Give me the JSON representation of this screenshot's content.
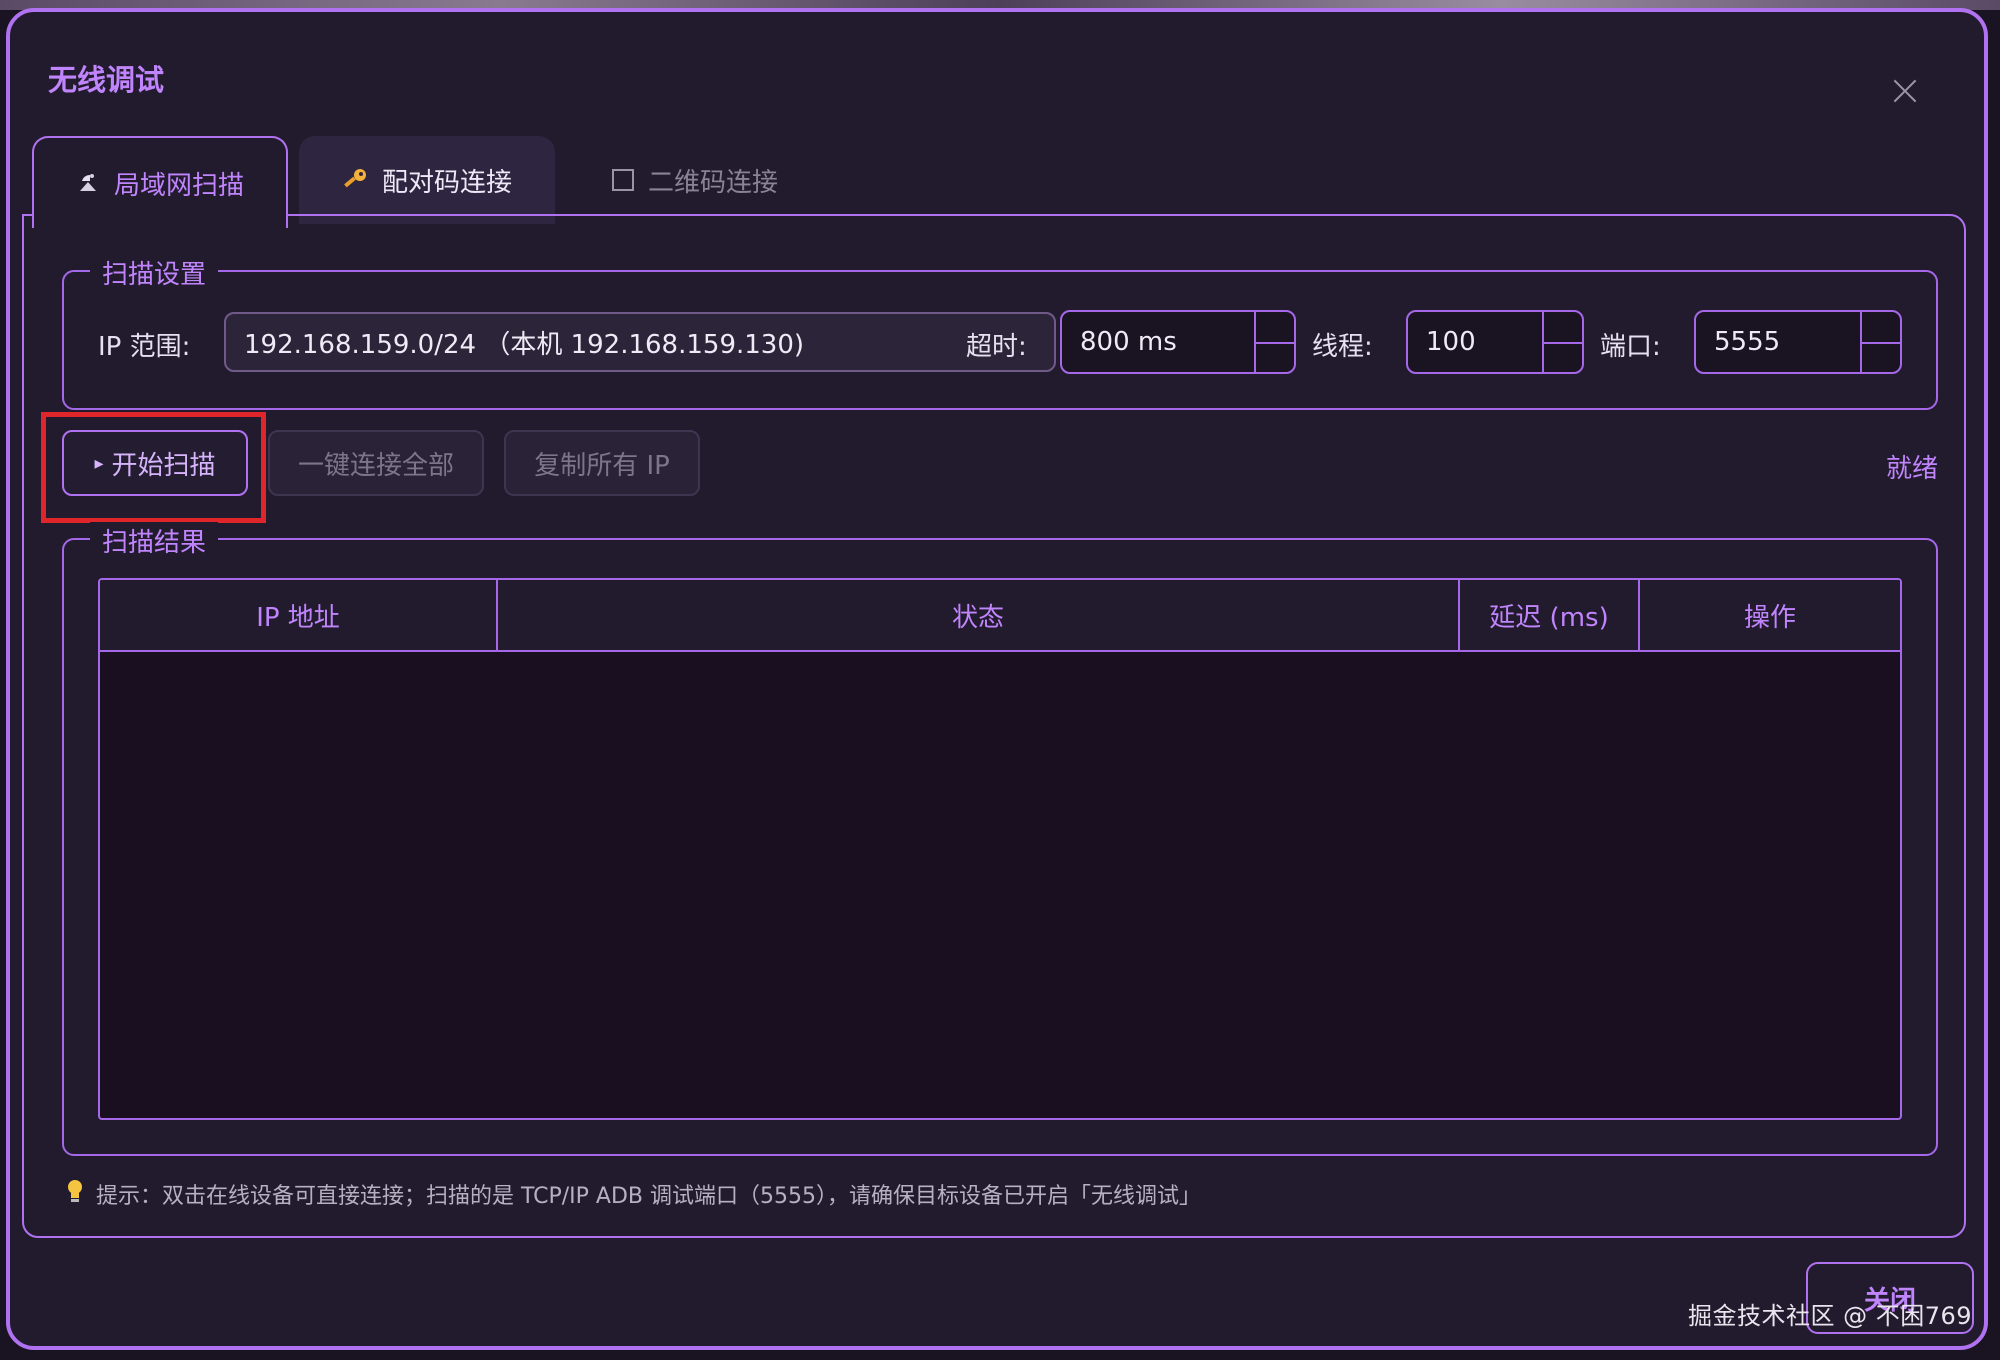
{
  "dialog": {
    "title": "无线调试",
    "close_icon": "close-icon"
  },
  "tabs": [
    {
      "label": "局域网扫描",
      "icon": "radar-dish-icon",
      "active": true
    },
    {
      "label": "配对码连接",
      "icon": "key-icon",
      "active": false
    },
    {
      "label": "二维码连接",
      "icon": "checkbox-icon",
      "active": false
    }
  ],
  "scan_settings": {
    "legend": "扫描设置",
    "ip_range_label": "IP 范围:",
    "ip_range_value": "192.168.159.0/24 （本机 192.168.159.130)",
    "timeout_label": "超时:",
    "timeout_value": "800 ms",
    "threads_label": "线程:",
    "threads_value": "100",
    "port_label": "端口:",
    "port_value": "5555"
  },
  "actions": {
    "start_scan": "开始扫描",
    "start_scan_icon": "▸",
    "connect_all": "一键连接全部",
    "copy_all_ip": "复制所有 IP",
    "status": "就绪"
  },
  "results": {
    "legend": "扫描结果",
    "columns": [
      "IP 地址",
      "状态",
      "延迟 (ms)",
      "操作"
    ],
    "rows": []
  },
  "tip": {
    "icon": "lightbulb-icon",
    "text": "提示：双击在线设备可直接连接；扫描的是 TCP/IP ADB 调试端口（5555），请确保目标设备已开启「无线调试」"
  },
  "footer": {
    "close_label": "关闭",
    "watermark": "掘金技术社区 @ 不困769"
  },
  "colors": {
    "accent": "#c084fc",
    "border": "#b072f0",
    "background": "#221b2e",
    "highlight": "#e0262b"
  }
}
